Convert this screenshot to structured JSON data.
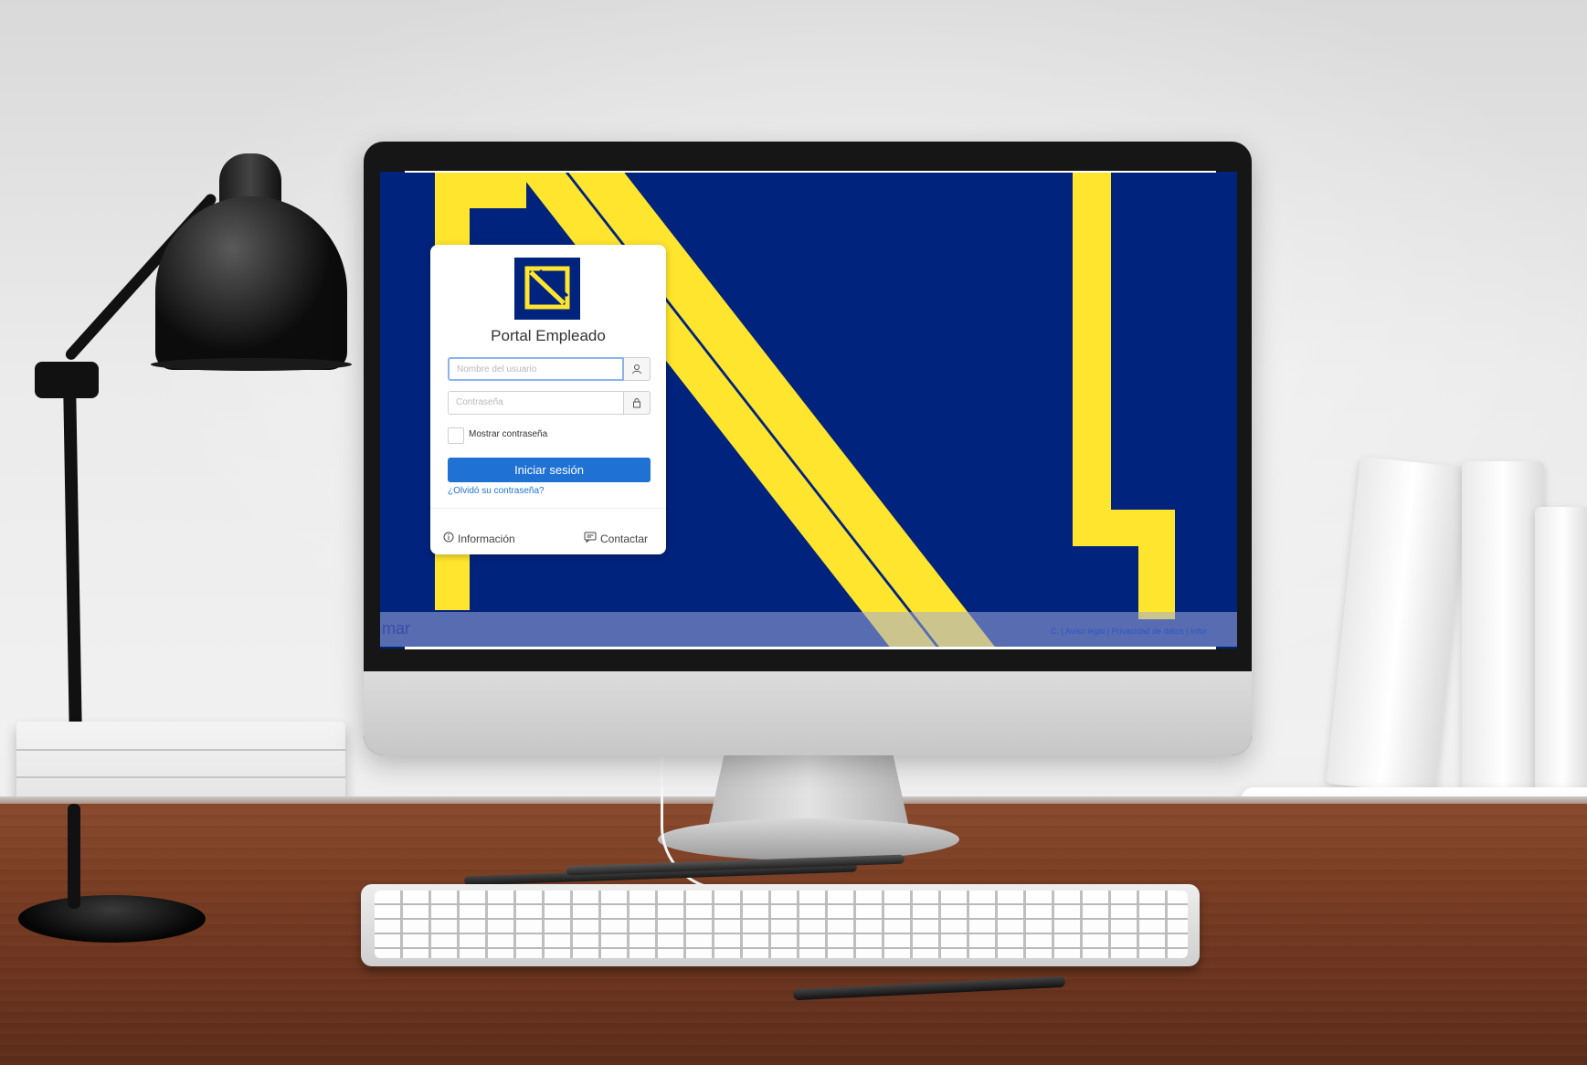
{
  "login_card": {
    "title": "Portal Empleado",
    "username_placeholder": "Nombre del usuario",
    "password_placeholder": "Contraseña",
    "show_password_label": "Mostrar contraseña",
    "submit_label": "Iniciar sesión",
    "forgot_label": "¿Olvidó su contraseña?",
    "info_label": "Información",
    "contact_label": "Contactar"
  },
  "footer": {
    "brand": "mar",
    "links": "C. | Aviso legal | Privacidad de datos | Infor"
  },
  "icons": {
    "username": "user-icon",
    "password": "lock-icon",
    "info": "info-circle-icon",
    "contact": "chat-icon"
  },
  "colors": {
    "screen_background": "#00237d",
    "stripe": "#ffe52e",
    "primary_button": "#1f72d4"
  }
}
